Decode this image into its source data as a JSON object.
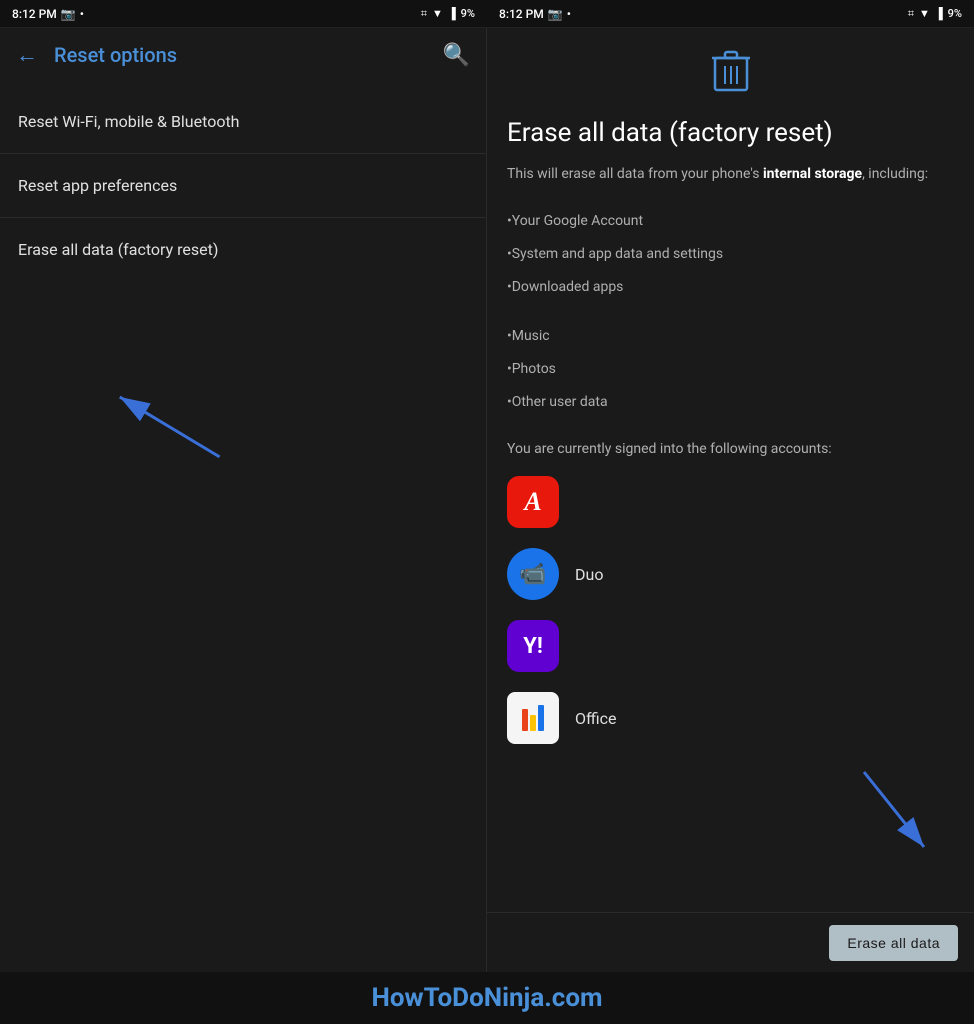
{
  "status": {
    "time": "8:12 PM",
    "time2": "8:12 PM",
    "battery": "9%",
    "battery2": "9%"
  },
  "left": {
    "back_label": "←",
    "title": "Reset options",
    "search_label": "🔍",
    "menu_items": [
      {
        "id": "wifi",
        "label": "Reset Wi-Fi, mobile & Bluetooth"
      },
      {
        "id": "app_prefs",
        "label": "Reset app preferences"
      },
      {
        "id": "factory",
        "label": "Erase all data (factory reset)"
      }
    ]
  },
  "right": {
    "title": "Erase all data (factory reset)",
    "description_prefix": "This will erase all data from your phone's ",
    "description_bold": "internal storage",
    "description_suffix": ", including:",
    "data_items": [
      {
        "id": "google",
        "label": "•Your Google Account"
      },
      {
        "id": "system",
        "label": "•System and app data and settings"
      },
      {
        "id": "downloaded",
        "label": "•Downloaded apps"
      },
      {
        "id": "music",
        "label": "•Music"
      },
      {
        "id": "photos",
        "label": "•Photos"
      },
      {
        "id": "other",
        "label": "•Other user data"
      }
    ],
    "accounts_label": "You are currently signed into the following accounts:",
    "accounts": [
      {
        "id": "adobe",
        "type": "adobe",
        "name": ""
      },
      {
        "id": "duo",
        "type": "duo",
        "name": "Duo"
      },
      {
        "id": "yahoo",
        "type": "yahoo",
        "name": ""
      },
      {
        "id": "office",
        "type": "office",
        "name": "Office"
      }
    ],
    "erase_button_label": "Erase all data"
  },
  "watermark": {
    "text": "HowToDoNinja.com"
  }
}
